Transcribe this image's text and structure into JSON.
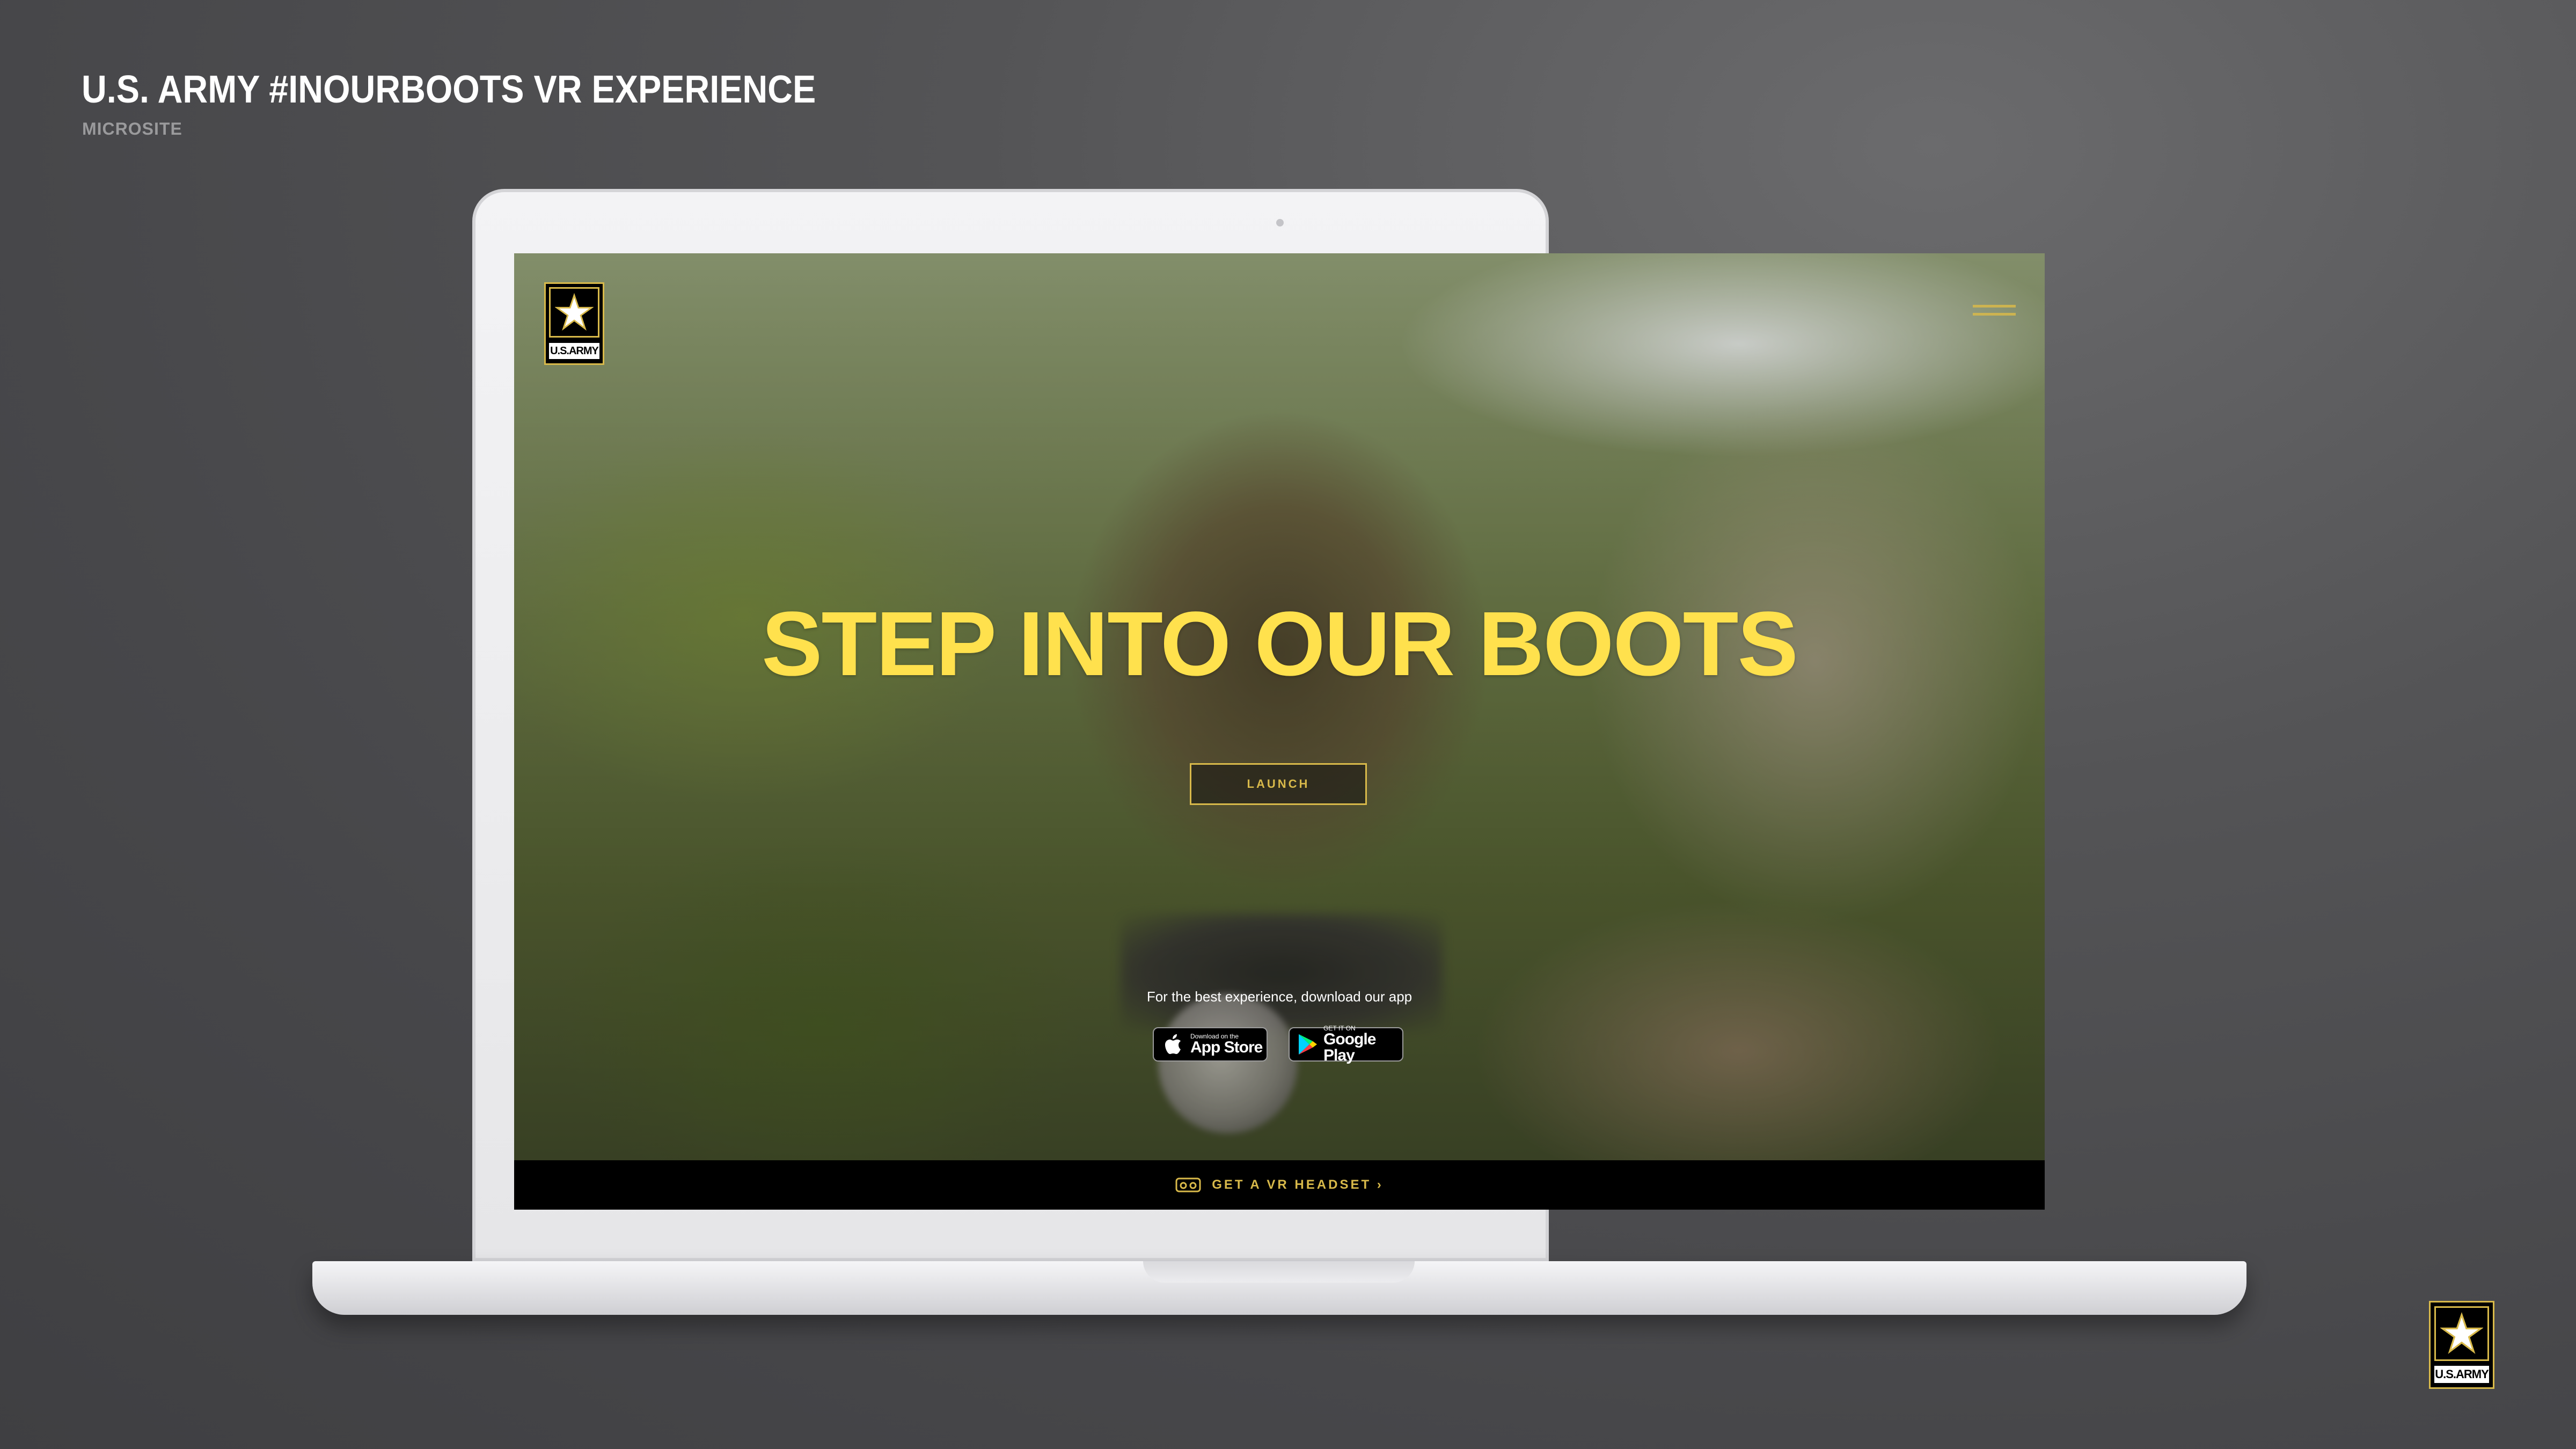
{
  "deck": {
    "title": "U.S. ARMY #INOURBOOTS VR EXPERIENCE",
    "subtitle": "MICROSITE"
  },
  "site": {
    "logo_text": "U.S.ARMY",
    "menu_icon": "hamburger-icon",
    "hero_heading": "STEP INTO OUR BOOTS",
    "launch_label": "LAUNCH",
    "app_note": "For the best experience, download our app",
    "app_store": {
      "small": "Download on the",
      "big": "App Store",
      "icon": "apple-icon"
    },
    "google_play": {
      "small": "GET IT ON",
      "big": "Google Play",
      "icon": "google-play-icon"
    },
    "footer_cta": "GET A VR HEADSET ›",
    "footer_icon": "vr-headset-icon"
  },
  "corner_logo_text": "U.S.ARMY",
  "colors": {
    "accent_gold": "#d8b94a",
    "hero_yellow": "#ffe14d",
    "background": "#4f4f52",
    "footer_bar": "#000000"
  }
}
